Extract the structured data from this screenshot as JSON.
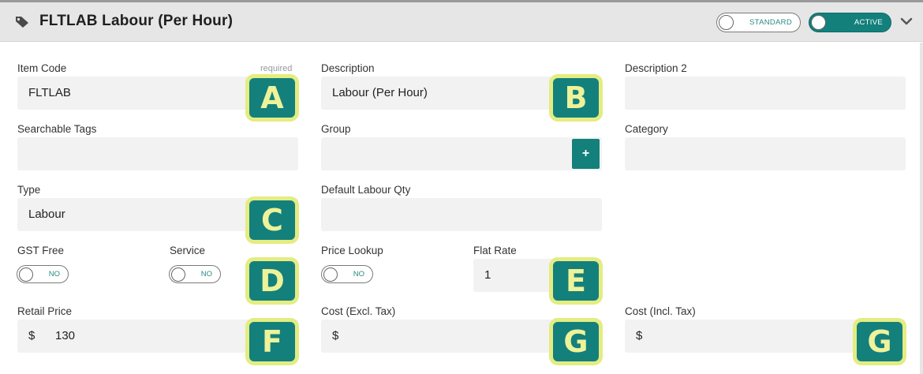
{
  "header": {
    "title": "FLTLAB Labour (Per Hour)",
    "standard_label": "STANDARD",
    "active_label": "ACTIVE"
  },
  "fields": {
    "item_code": {
      "label": "Item Code",
      "required": "required",
      "value": "FLTLAB"
    },
    "description": {
      "label": "Description",
      "value": "Labour (Per Hour)"
    },
    "description2": {
      "label": "Description 2",
      "value": ""
    },
    "searchable_tags": {
      "label": "Searchable Tags",
      "value": ""
    },
    "group": {
      "label": "Group",
      "value": "",
      "add_label": "+"
    },
    "category": {
      "label": "Category",
      "value": ""
    },
    "type": {
      "label": "Type",
      "value": "Labour"
    },
    "default_labour_qty": {
      "label": "Default Labour Qty",
      "value": ""
    },
    "gst_free": {
      "label": "GST Free",
      "toggle": "NO"
    },
    "service": {
      "label": "Service",
      "toggle": "NO"
    },
    "price_lookup": {
      "label": "Price Lookup",
      "toggle": "NO"
    },
    "flat_rate": {
      "label": "Flat Rate",
      "value": "1"
    },
    "retail_price": {
      "label": "Retail Price",
      "currency": "$",
      "value": "130"
    },
    "cost_excl": {
      "label": "Cost (Excl. Tax)",
      "currency": "$",
      "value": ""
    },
    "cost_incl": {
      "label": "Cost (Incl. Tax)",
      "currency": "$",
      "value": ""
    }
  },
  "badges": {
    "a": "A",
    "b": "B",
    "c": "C",
    "d": "D",
    "e": "E",
    "f": "F",
    "g1": "G",
    "g2": "G"
  },
  "colors": {
    "accent": "#13807c",
    "badge_border": "#e4ec82",
    "badge_text": "#eef299",
    "field_bg": "#f2f2f2",
    "header_bg": "#e6e6e6"
  }
}
